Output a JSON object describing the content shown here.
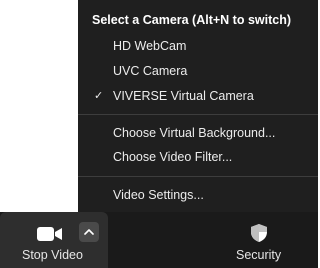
{
  "camera_menu": {
    "header": "Select a Camera (Alt+N to switch)",
    "cameras": [
      {
        "label": "HD WebCam",
        "selected": false
      },
      {
        "label": "UVC Camera",
        "selected": false
      },
      {
        "label": "VIVERSE Virtual Camera",
        "selected": true
      }
    ],
    "check_glyph": "✓",
    "choose_background": "Choose Virtual Background...",
    "choose_filter": "Choose Video Filter...",
    "video_settings": "Video Settings..."
  },
  "toolbar": {
    "stop_video_label": "Stop Video",
    "security_label": "Security",
    "icons": {
      "video": "video-camera-icon",
      "caret": "chevron-up-icon",
      "security": "shield-icon"
    }
  },
  "colors": {
    "menu_bg": "#1f1f1f",
    "toolbar_bg": "#1a1a1a",
    "stop_video_bg": "#2e2e2e",
    "text": "#ececec"
  }
}
